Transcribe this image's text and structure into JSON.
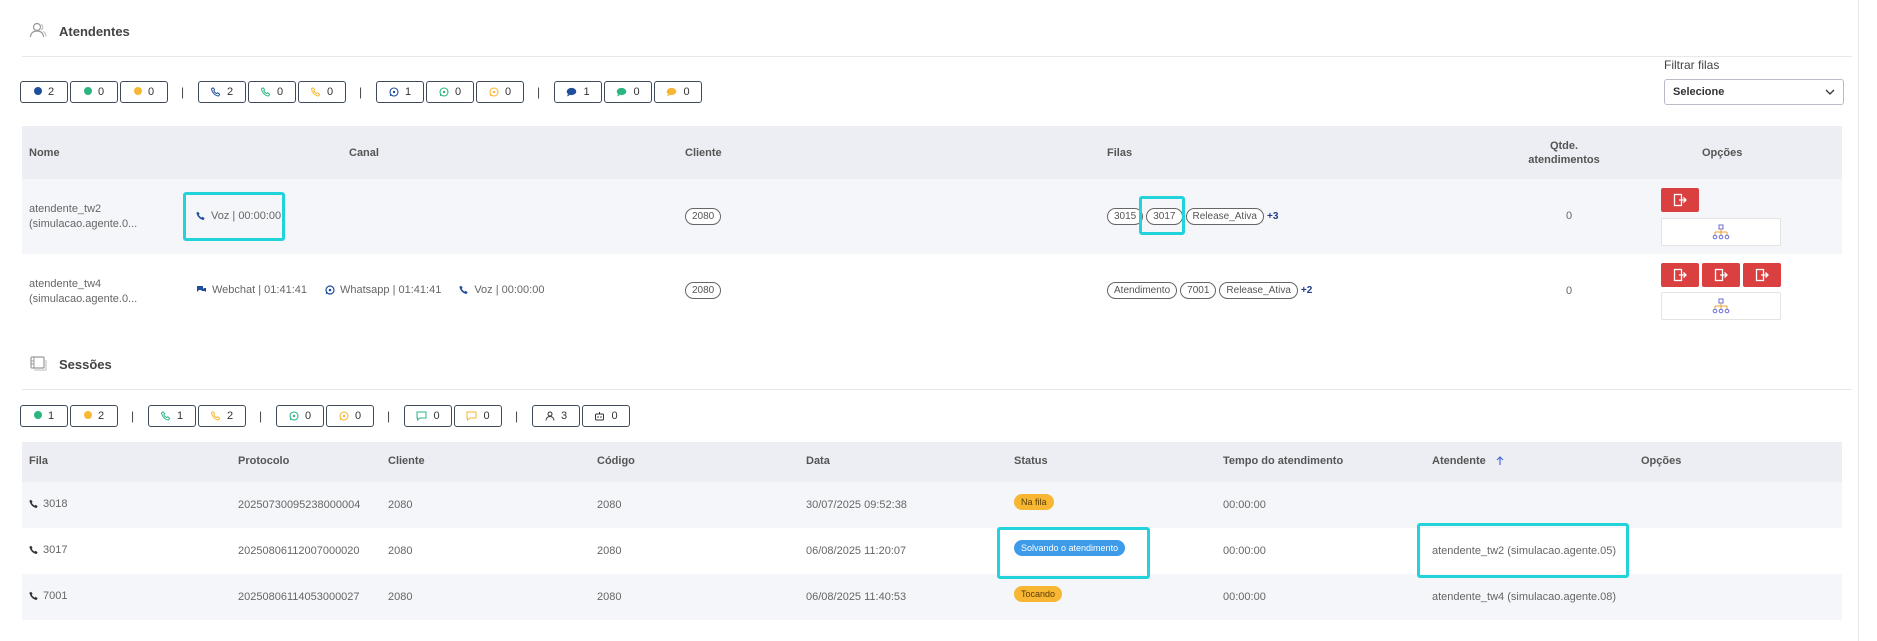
{
  "attendants_section": {
    "title": "Atendentes",
    "icon": "users-icon",
    "filter": {
      "label": "Filtrar filas",
      "select_value": "Selecione"
    },
    "status_chips": [
      {
        "count": "2",
        "kind": "dot",
        "color": "#1f4e9a"
      },
      {
        "count": "0",
        "kind": "dot",
        "color": "#2cb57f"
      },
      {
        "count": "0",
        "kind": "dot",
        "color": "#f7b733"
      },
      {
        "count": "2",
        "kind": "phone",
        "color": "#1f4e9a"
      },
      {
        "count": "0",
        "kind": "phone",
        "color": "#2cb57f"
      },
      {
        "count": "0",
        "kind": "phone",
        "color": "#f7b733"
      },
      {
        "count": "1",
        "kind": "whatsapp",
        "color": "#1f4e9a"
      },
      {
        "count": "0",
        "kind": "whatsapp",
        "color": "#2cb57f"
      },
      {
        "count": "0",
        "kind": "whatsapp",
        "color": "#f7b733"
      },
      {
        "count": "1",
        "kind": "chat",
        "color": "#1f4e9a"
      },
      {
        "count": "0",
        "kind": "chat",
        "color": "#2cb57f"
      },
      {
        "count": "0",
        "kind": "chat",
        "color": "#f7b733"
      }
    ],
    "separator": "|",
    "table": {
      "headers": {
        "nome": "Nome",
        "canal": "Canal",
        "cliente": "Cliente",
        "filas": "Filas",
        "qtde_line1": "Qtde.",
        "qtde_line2": "atendimentos",
        "opcoes": "Opções"
      },
      "rows": [
        {
          "name_line1": "atendente_tw2",
          "name_line2": "(simulacao.agente.0...",
          "channels": [
            {
              "icon": "phone-icon",
              "text": "Voz | 00:00:00"
            }
          ],
          "client": "2080",
          "queues": [
            "3015",
            "3017",
            "Release_Ativa"
          ],
          "queues_more": "+3",
          "count": "0"
        },
        {
          "name_line1": "atendente_tw4",
          "name_line2": "(simulacao.agente.0...",
          "channels": [
            {
              "icon": "chat-icon",
              "text": "Webchat | 01:41:41"
            },
            {
              "icon": "whatsapp-icon",
              "text": "Whatsapp | 01:41:41"
            },
            {
              "icon": "phone-icon",
              "text": "Voz | 00:00:00"
            }
          ],
          "client": "2080",
          "queues": [
            "Atendimento",
            "7001",
            "Release_Ativa"
          ],
          "queues_more": "+2",
          "count": "0"
        }
      ]
    }
  },
  "sessions_section": {
    "title": "Sessões",
    "icon": "sessions-icon",
    "status_chips": [
      {
        "count": "1",
        "kind": "dot",
        "color": "#2cb57f"
      },
      {
        "count": "2",
        "kind": "dot",
        "color": "#f7b733"
      },
      {
        "count": "1",
        "kind": "phone",
        "color": "#2cb57f"
      },
      {
        "count": "2",
        "kind": "phone",
        "color": "#f7b733"
      },
      {
        "count": "0",
        "kind": "whatsapp",
        "color": "#2cb57f"
      },
      {
        "count": "0",
        "kind": "whatsapp",
        "color": "#f7b733"
      },
      {
        "count": "0",
        "kind": "message",
        "color": "#2cb57f"
      },
      {
        "count": "0",
        "kind": "message",
        "color": "#f7b733"
      },
      {
        "count": "3",
        "kind": "person",
        "color": "#333333"
      },
      {
        "count": "0",
        "kind": "robot",
        "color": "#333333"
      }
    ],
    "table": {
      "headers": {
        "fila": "Fila",
        "protocolo": "Protocolo",
        "cliente": "Cliente",
        "codigo": "Código",
        "data": "Data",
        "status": "Status",
        "tempo": "Tempo do atendimento",
        "atendente": "Atendente",
        "opcoes": "Opções"
      },
      "rows": [
        {
          "fila": "3018",
          "protocolo": "20250730095238000004",
          "cliente": "2080",
          "codigo": "2080",
          "data": "30/07/2025 09:52:38",
          "status": "Na fila",
          "status_color": "#f7b733",
          "status_text_color": "#5a3d00",
          "tempo": "00:00:00",
          "atendente": ""
        },
        {
          "fila": "3017",
          "protocolo": "20250806112007000020",
          "cliente": "2080",
          "codigo": "2080",
          "data": "06/08/2025 11:20:07",
          "status": "Solvando o atendimento",
          "status_color": "#3d9be9",
          "status_text_color": "#ffffff",
          "tempo": "00:00:00",
          "atendente": "atendente_tw2 (simulacao.agente.05)"
        },
        {
          "fila": "7001",
          "protocolo": "20250806114053000027",
          "cliente": "2080",
          "codigo": "2080",
          "data": "06/08/2025 11:40:53",
          "status": "Tocando",
          "status_color": "#f7b733",
          "status_text_color": "#5a3d00",
          "tempo": "00:00:00",
          "atendente": "atendente_tw4 (simulacao.agente.08)"
        }
      ]
    },
    "sort_icon": "arrow-up-icon"
  },
  "colors": {
    "highlight": "#22d3dc",
    "danger": "#d9403f",
    "header_bg": "#eceef3",
    "row_alt": "#f5f6f9"
  }
}
